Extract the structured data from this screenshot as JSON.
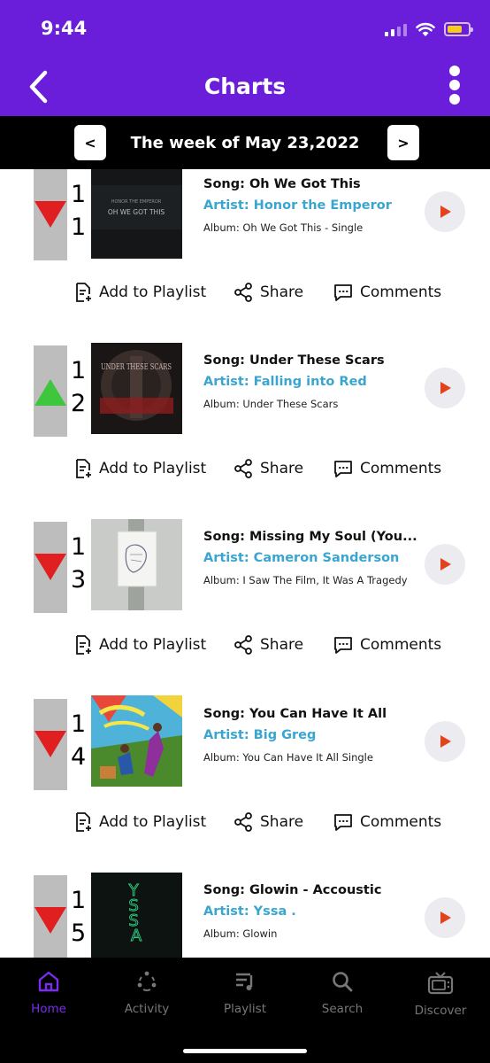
{
  "status_bar": {
    "time": "9:44"
  },
  "header": {
    "title": "Charts"
  },
  "week": {
    "label": "The week of May 23,2022",
    "prev": "<",
    "next": ">"
  },
  "actions": {
    "add": "Add to Playlist",
    "share": "Share",
    "comments": "Comments"
  },
  "items": [
    {
      "rank_a": "1",
      "rank_b": "1",
      "trend": "down",
      "song": "Song: Oh We Got This",
      "artist": "Artist: Honor the Emperor",
      "album": "Album: Oh We Got This - Single"
    },
    {
      "rank_a": "1",
      "rank_b": "2",
      "trend": "up",
      "song": "Song: Under These Scars",
      "artist": "Artist: Falling into Red",
      "album": "Album: Under These Scars"
    },
    {
      "rank_a": "1",
      "rank_b": "3",
      "trend": "down",
      "song": "Song: Missing My Soul (You...",
      "artist": "Artist: Cameron Sanderson",
      "album": "Album: I Saw The Film, It Was A Tragedy"
    },
    {
      "rank_a": "1",
      "rank_b": "4",
      "trend": "down",
      "song": "Song: You Can Have It All",
      "artist": "Artist: Big Greg",
      "album": "Album: You Can Have It All Single"
    },
    {
      "rank_a": "1",
      "rank_b": "5",
      "trend": "down",
      "song": "Song: Glowin - Accoustic",
      "artist": "Artist: Yssa .",
      "album": "Album: Glowin"
    }
  ],
  "artwork_text": {
    "item1": "OH WE GOT THIS",
    "item1_small": "HONOR THE EMPEROR",
    "item2": "UNDER THESE SCARS",
    "item5": "YSSA"
  },
  "tabs": [
    {
      "label": "Home",
      "icon": "home-icon",
      "active": true
    },
    {
      "label": "Activity",
      "icon": "activity-icon",
      "active": false
    },
    {
      "label": "Playlist",
      "icon": "playlist-icon",
      "active": false
    },
    {
      "label": "Search",
      "icon": "search-icon",
      "active": false
    },
    {
      "label": "Discover",
      "icon": "tv-icon",
      "active": false
    }
  ],
  "colors": {
    "header": "#6a1ed9",
    "trend_down": "#e02020",
    "trend_up": "#3ec63e",
    "artist": "#3aa6cf",
    "play": "#e2431d",
    "tab_active": "#7a2cf0"
  }
}
